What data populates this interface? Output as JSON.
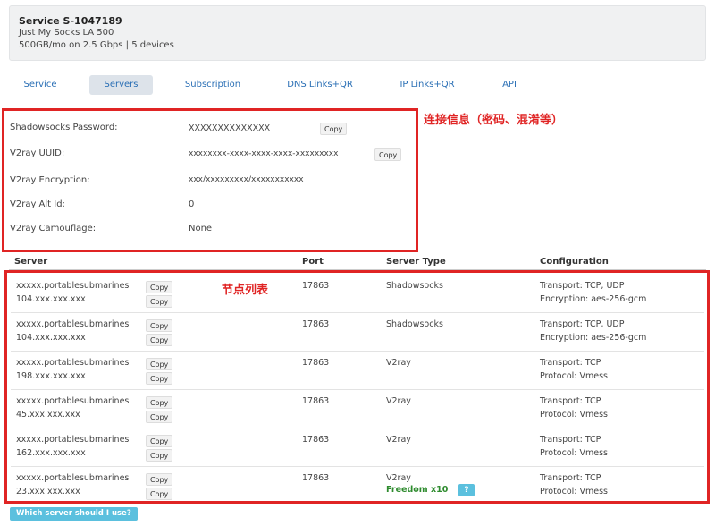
{
  "service": {
    "title": "Service S-1047189",
    "plan": "Just My Socks LA 500",
    "details": "500GB/mo on 2.5 Gbps | 5 devices"
  },
  "tabs": [
    {
      "label": "Service"
    },
    {
      "label": "Servers",
      "active": true
    },
    {
      "label": "Subscription"
    },
    {
      "label": "DNS Links+QR"
    },
    {
      "label": "IP Links+QR"
    },
    {
      "label": "API"
    }
  ],
  "credentials": {
    "ss_password_label": "Shadowsocks Password:",
    "ss_password_value": "XXXXXXXXXXXXXX",
    "uuid_label": "V2ray UUID:",
    "uuid_value": "xxxxxxxx-xxxx-xxxx-xxxx-xxxxxxxxx",
    "encryption_label": "V2ray Encryption:",
    "encryption_value": "xxx/xxxxxxxxx/xxxxxxxxxxx",
    "alt_id_label": "V2ray Alt Id:",
    "alt_id_value": "0",
    "camouflage_label": "V2ray Camouflage:",
    "camouflage_value": "None",
    "copy_label": "Copy"
  },
  "annotations": {
    "credentials_note": "连接信息（密码、混淆等）",
    "servers_note": "节点列表",
    "highlight_color": "#e02424"
  },
  "table": {
    "headers": [
      "Server",
      "Port",
      "Server Type",
      "Configuration"
    ],
    "copy_label": "Copy",
    "rows": [
      {
        "host": "xxxxx.portablesubmarines",
        "ip": "104.xxx.xxx.xxx",
        "port": "17863",
        "type": "Shadowsocks",
        "conf1": "Transport: TCP, UDP",
        "conf2": "Encryption: aes-256-gcm"
      },
      {
        "host": "xxxxx.portablesubmarines",
        "ip": "104.xxx.xxx.xxx",
        "port": "17863",
        "type": "Shadowsocks",
        "conf1": "Transport: TCP, UDP",
        "conf2": "Encryption: aes-256-gcm"
      },
      {
        "host": "xxxxx.portablesubmarines",
        "ip": "198.xxx.xxx.xxx",
        "port": "17863",
        "type": "V2ray",
        "conf1": "Transport: TCP",
        "conf2": "Protocol: Vmess"
      },
      {
        "host": "xxxxx.portablesubmarines",
        "ip": "45.xxx.xxx.xxx",
        "port": "17863",
        "type": "V2ray",
        "conf1": "Transport: TCP",
        "conf2": "Protocol: Vmess"
      },
      {
        "host": "xxxxx.portablesubmarines",
        "ip": "162.xxx.xxx.xxx",
        "port": "17863",
        "type": "V2ray",
        "conf1": "Transport: TCP",
        "conf2": "Protocol: Vmess"
      },
      {
        "host": "xxxxx.portablesubmarines",
        "ip": "23.xxx.xxx.xxx",
        "port": "17863",
        "type": "V2ray",
        "freedom": "Freedom x10",
        "help_q": "?",
        "conf1": "Transport: TCP",
        "conf2": "Protocol: Vmess"
      }
    ]
  },
  "help_button": "Which server should I use?"
}
